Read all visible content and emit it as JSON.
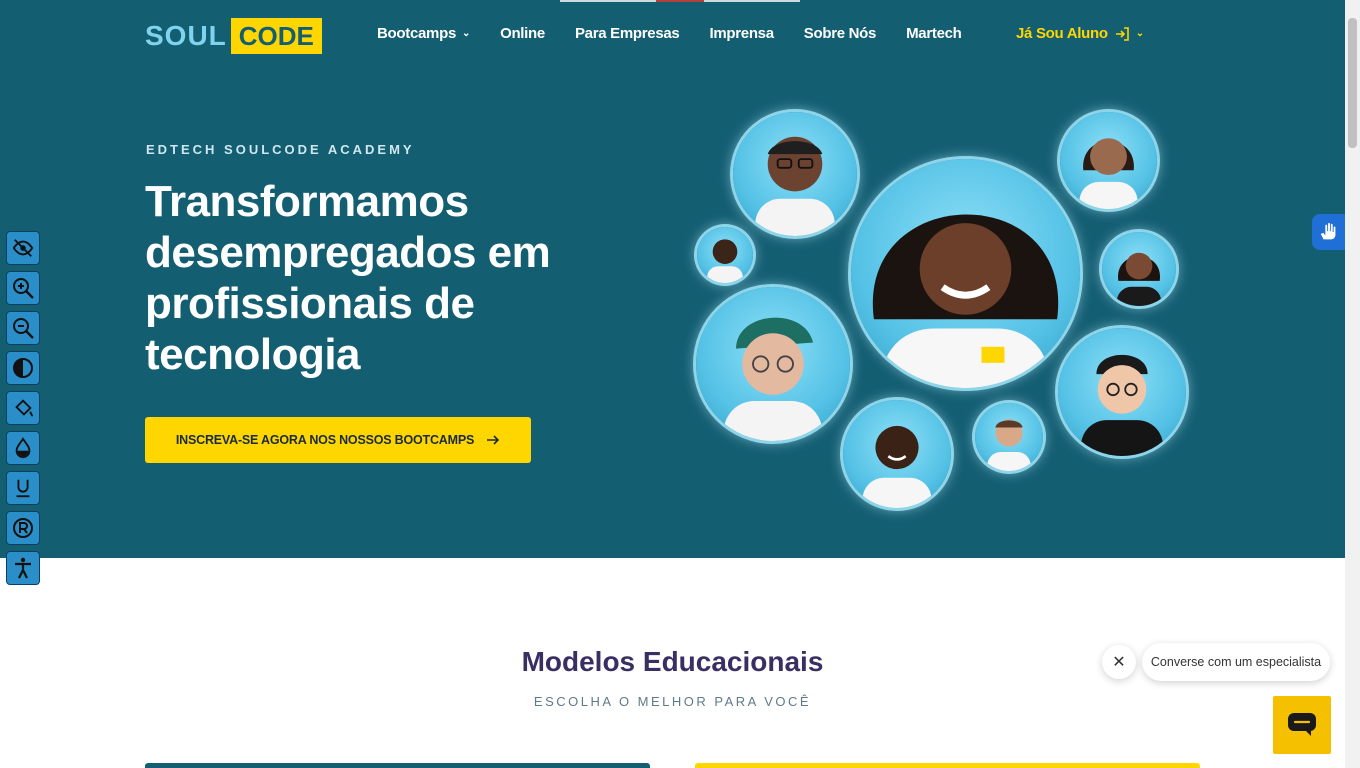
{
  "header": {
    "logo_soul": "SOUL",
    "logo_code": "CODE",
    "nav": [
      {
        "label": "Bootcamps",
        "dropdown": true
      },
      {
        "label": "Online",
        "dropdown": false
      },
      {
        "label": "Para Empresas",
        "dropdown": false
      },
      {
        "label": "Imprensa",
        "dropdown": false
      },
      {
        "label": "Sobre Nós",
        "dropdown": false
      },
      {
        "label": "Martech",
        "dropdown": false
      }
    ],
    "student_login": "Já Sou Aluno"
  },
  "hero": {
    "eyebrow": "EDTECH SOULCODE ACADEMY",
    "headline": "Transformamos desempregados em profissionais de tecnologia",
    "cta_label": "INSCREVA-SE AGORA NOS NOSSOS BOOTCAMPS",
    "cta_icon": "arrow-right-icon"
  },
  "accessibility_toolbar": {
    "icons": [
      "eye-slash-icon",
      "zoom-in-icon",
      "zoom-out-icon",
      "contrast-icon",
      "paint-bucket-icon",
      "drop-icon",
      "underline-icon",
      "reset-icon",
      "accessibility-person-icon"
    ]
  },
  "models": {
    "title": "Modelos Educacionais",
    "subtitle": "ESCOLHA O MELHOR PARA VOCÊ"
  },
  "chat": {
    "prompt": "Converse com um especialista"
  },
  "colors": {
    "hero_bg": "#145e72",
    "accent_yellow": "#ffd600",
    "title_purple": "#3a2f63"
  }
}
